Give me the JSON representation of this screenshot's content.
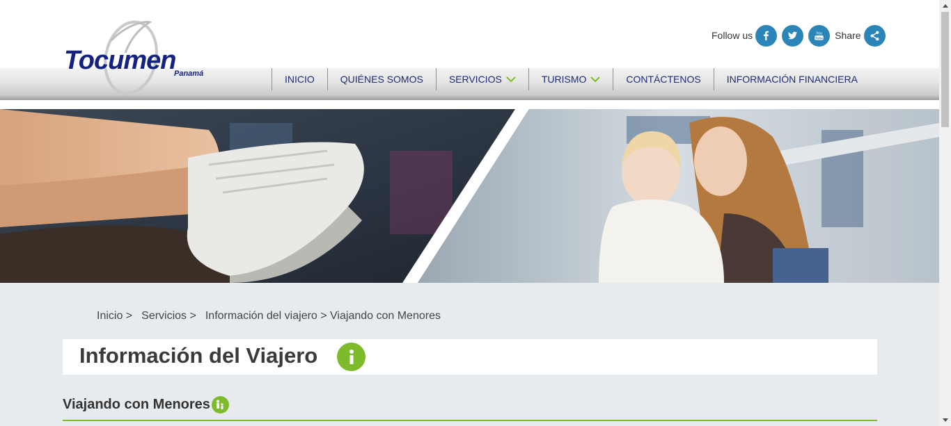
{
  "brand": {
    "name": "Tocumen",
    "sub": "Panamá",
    "color": "#13237f"
  },
  "social": {
    "follow_label": "Follow us",
    "share_label": "Share",
    "icons": [
      "facebook-icon",
      "twitter-icon",
      "youtube-icon",
      "share-icon"
    ],
    "icon_color": "#2b85b9"
  },
  "nav": {
    "items": [
      {
        "label": "INICIO",
        "dropdown": false
      },
      {
        "label": "QUIÉNES SOMOS",
        "dropdown": false
      },
      {
        "label": "SERVICIOS",
        "dropdown": true
      },
      {
        "label": "TURISMO",
        "dropdown": true
      },
      {
        "label": "CONTÁCTENOS",
        "dropdown": false
      },
      {
        "label": "INFORMACIÓN FINANCIERA",
        "dropdown": false
      }
    ],
    "text_color": "#1b2a78",
    "chevron_color": "#7dbb2d"
  },
  "breadcrumb": {
    "items": [
      "Inicio >",
      "Servicios >",
      "Información del viajero > Viajando con Menores"
    ]
  },
  "page": {
    "title": "Información del Viajero",
    "section_title": "Viajando con Menores",
    "accent": "#7dbb2d"
  }
}
